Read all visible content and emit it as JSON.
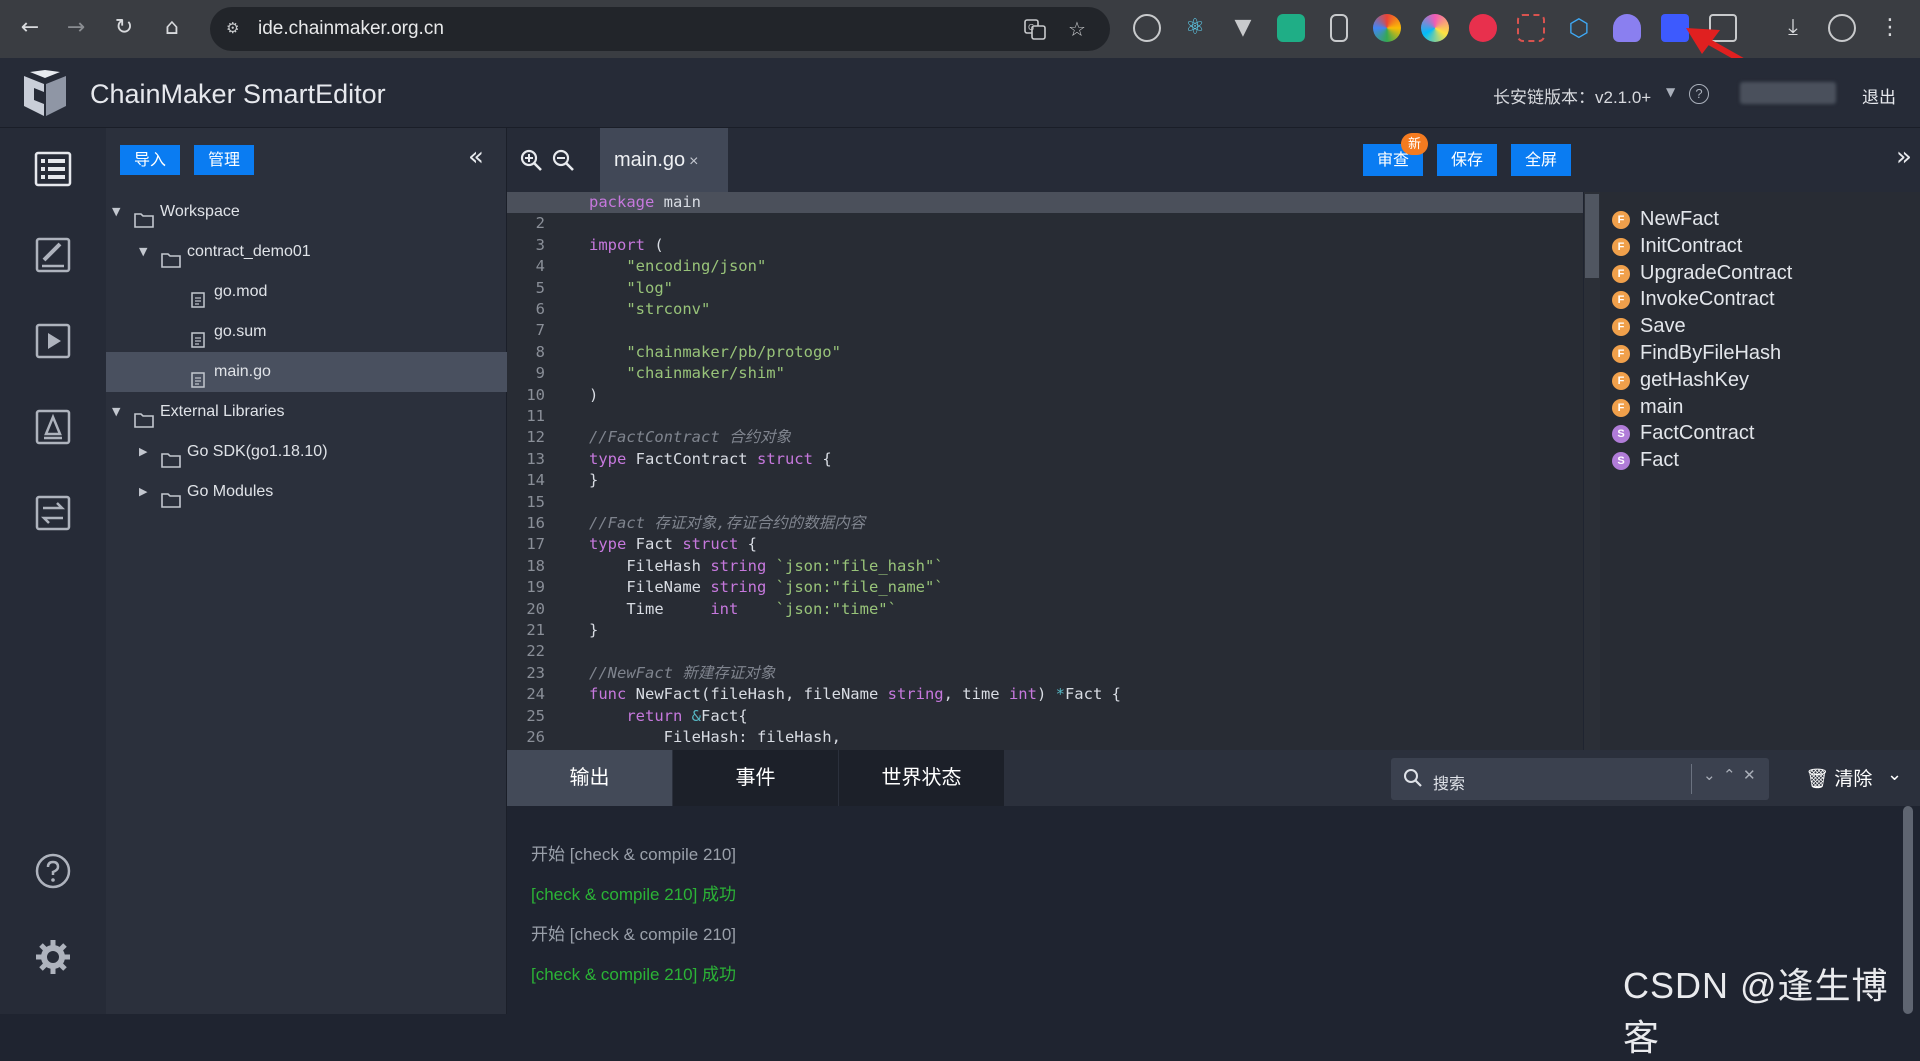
{
  "browser": {
    "url": "ide.chainmaker.org.cn"
  },
  "app": {
    "title": "ChainMaker SmartEditor",
    "version_label": "长安链版本：",
    "version_value": "v2.1.0+",
    "help_glyph": "?",
    "logout": "退出"
  },
  "file_panel": {
    "import_btn": "导入",
    "manage_btn": "管理",
    "tree": [
      {
        "label": "Workspace",
        "depth": 0,
        "type": "folder",
        "expanded": true
      },
      {
        "label": "contract_demo01",
        "depth": 1,
        "type": "folder",
        "expanded": true
      },
      {
        "label": "go.mod",
        "depth": 2,
        "type": "file"
      },
      {
        "label": "go.sum",
        "depth": 2,
        "type": "file"
      },
      {
        "label": "main.go",
        "depth": 2,
        "type": "file",
        "selected": true
      },
      {
        "label": "External Libraries",
        "depth": 0,
        "type": "folder",
        "expanded": true
      },
      {
        "label": "Go SDK(go1.18.10)",
        "depth": 1,
        "type": "folder",
        "expanded": false
      },
      {
        "label": "Go Modules",
        "depth": 1,
        "type": "folder",
        "expanded": false
      }
    ]
  },
  "editor": {
    "tab_name": "main.go",
    "tab_close": "×",
    "review_btn": "审查",
    "new_badge": "新",
    "save_btn": "保存",
    "fullscreen_btn": "全屏",
    "active_line": 1,
    "lines": [
      "package main",
      "",
      "import (",
      "    \"encoding/json\"",
      "    \"log\"",
      "    \"strconv\"",
      "",
      "    \"chainmaker/pb/protogo\"",
      "    \"chainmaker/shim\"",
      ")",
      "",
      "//FactContract 合约对象",
      "type FactContract struct {",
      "}",
      "",
      "//Fact 存证对象,存证合约的数据内容",
      "type Fact struct {",
      "    FileHash string `json:\"file_hash\"`",
      "    FileName string `json:\"file_name\"`",
      "    Time     int    `json:\"time\"`",
      "}",
      "",
      "//NewFact 新建存证对象",
      "func NewFact(fileHash, fileName string, time int) *Fact {",
      "    return &Fact{",
      "        FileHash: fileHash,"
    ]
  },
  "outline": [
    {
      "kind": "F",
      "name": "NewFact"
    },
    {
      "kind": "F",
      "name": "InitContract"
    },
    {
      "kind": "F",
      "name": "UpgradeContract"
    },
    {
      "kind": "F",
      "name": "InvokeContract"
    },
    {
      "kind": "F",
      "name": "Save"
    },
    {
      "kind": "F",
      "name": "FindByFileHash"
    },
    {
      "kind": "F",
      "name": "getHashKey"
    },
    {
      "kind": "F",
      "name": "main"
    },
    {
      "kind": "S",
      "name": "FactContract"
    },
    {
      "kind": "S",
      "name": "Fact"
    }
  ],
  "bottom": {
    "tabs": [
      "输出",
      "事件",
      "世界状态"
    ],
    "active_tab": 0,
    "search_placeholder": "搜索",
    "clear_btn": "清除",
    "output": [
      {
        "text": "开始 [check & compile 210]",
        "status": "info"
      },
      {
        "text": "[check & compile 210] 成功",
        "status": "success"
      },
      {
        "text": "开始 [check & compile 210]",
        "status": "info"
      },
      {
        "text": "[check & compile 210] 成功",
        "status": "success"
      }
    ]
  },
  "watermark": "CSDN @逢生博客",
  "colors": {
    "accent": "#0a7cf2",
    "badge": "#f47b20",
    "func_badge": "#f0a04b",
    "struct_badge": "#b07cd8",
    "success": "#2bb336"
  }
}
